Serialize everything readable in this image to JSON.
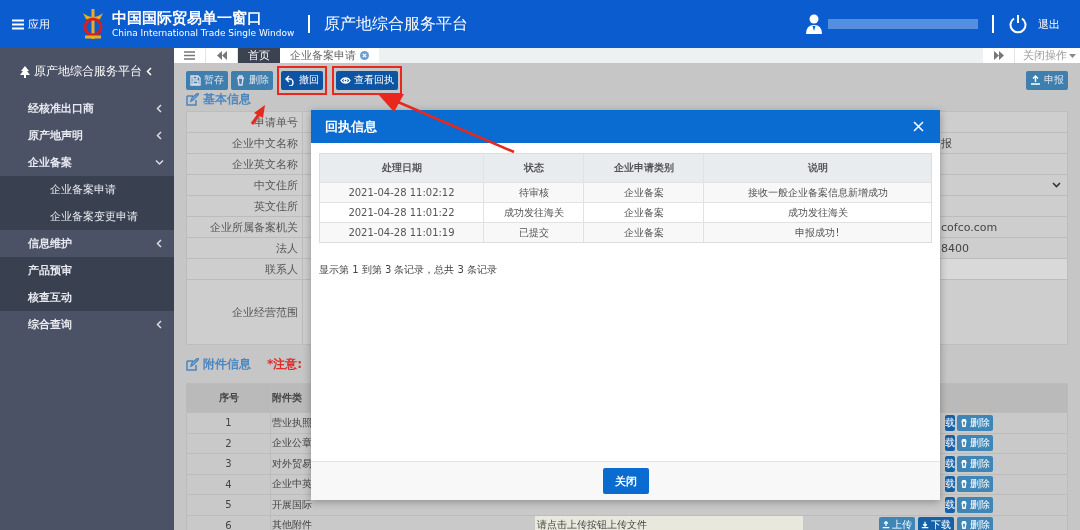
{
  "header": {
    "menu_label": "应用",
    "logo_title": "中国国际贸易单一窗口",
    "logo_subtitle": "China International Trade Single Window",
    "platform": "原产地综合服务平台",
    "logout": "退出"
  },
  "sidebar": {
    "title": "原产地综合服务平台",
    "items": [
      {
        "label": "经核准出口商",
        "kind": "group",
        "expanded": false
      },
      {
        "label": "原产地声明",
        "kind": "group",
        "expanded": false
      },
      {
        "label": "企业备案",
        "kind": "group",
        "expanded": true,
        "children": [
          {
            "label": "企业备案申请"
          },
          {
            "label": "企业备案变更申请"
          }
        ]
      },
      {
        "label": "信息维护",
        "kind": "group",
        "expanded": false
      },
      {
        "label": "产品预审",
        "kind": "link"
      },
      {
        "label": "核查互动",
        "kind": "link"
      },
      {
        "label": "综合查询",
        "kind": "group",
        "expanded": false
      }
    ]
  },
  "tabs": [
    {
      "label": "首页",
      "selected": true,
      "closable": false
    },
    {
      "label": "企业备案申请",
      "selected": false,
      "closable": true
    }
  ],
  "close_ops": "关闭操作",
  "toolbar": {
    "buttons": [
      {
        "label": "暂存",
        "kind": "save",
        "highlighted": false
      },
      {
        "label": "删除",
        "kind": "delete",
        "highlighted": false
      },
      {
        "label": "撤回",
        "kind": "withdraw",
        "highlighted": true
      },
      {
        "label": "查看回执",
        "kind": "view",
        "highlighted": true
      }
    ],
    "submit": "申报"
  },
  "basic_info": {
    "title": "基本信息",
    "fields": [
      {
        "label": "申请单号",
        "kind": "text"
      },
      {
        "label": "企业中文名称",
        "kind": "text",
        "value": "报"
      },
      {
        "label": "企业英文名称",
        "kind": "text"
      },
      {
        "label": "中文住所",
        "kind": "select"
      },
      {
        "label": "英文住所",
        "kind": "text"
      },
      {
        "label": "企业所属备案机关",
        "kind": "text",
        "value": "cofco.com"
      },
      {
        "label": "法人",
        "kind": "text",
        "value": "8400"
      },
      {
        "label": "联系人",
        "kind": "input"
      },
      {
        "label": "企业经营范围",
        "kind": "area"
      }
    ]
  },
  "attachments": {
    "title": "附件信息",
    "note": "*注意:",
    "columns": [
      "序号",
      "附件类"
    ],
    "rows": [
      {
        "seq": "1",
        "type": "营业执照",
        "actions": [
          {
            "label": "载",
            "kind": "download"
          },
          {
            "label": "删除",
            "kind": "delete"
          }
        ]
      },
      {
        "seq": "2",
        "type": "企业公章",
        "actions": [
          {
            "label": "载",
            "kind": "download"
          },
          {
            "label": "删除",
            "kind": "delete"
          }
        ]
      },
      {
        "seq": "3",
        "type": "对外贸易",
        "actions": [
          {
            "label": "载",
            "kind": "download"
          },
          {
            "label": "删除",
            "kind": "delete"
          }
        ]
      },
      {
        "seq": "4",
        "type": "企业中英",
        "actions": [
          {
            "label": "载",
            "kind": "download"
          },
          {
            "label": "删除",
            "kind": "delete"
          }
        ]
      },
      {
        "seq": "5",
        "type": "开展国际",
        "actions": [
          {
            "label": "载",
            "kind": "download"
          },
          {
            "label": "删除",
            "kind": "delete"
          }
        ]
      },
      {
        "seq": "6",
        "type": "其他附件",
        "hint": "请点击上传按钮上传文件",
        "actions": [
          {
            "label": "上传",
            "kind": "upload"
          },
          {
            "label": "下载",
            "kind": "download"
          },
          {
            "label": "删除",
            "kind": "delete"
          }
        ]
      }
    ]
  },
  "modal": {
    "title": "回执信息",
    "columns": [
      "处理日期",
      "状态",
      "企业申请类别",
      "说明"
    ],
    "rows": [
      [
        "2021-04-28 11:02:12",
        "待审核",
        "企业备案",
        "接收一般企业备案信息新增成功"
      ],
      [
        "2021-04-28 11:01:22",
        "成功发往海关",
        "企业备案",
        "成功发往海关"
      ],
      [
        "2021-04-28 11:01:19",
        "已提交",
        "企业备案",
        "申报成功!"
      ]
    ],
    "summary": "显示第 1 到第 3 条记录，总共 3 条记录",
    "close": "关闭"
  }
}
